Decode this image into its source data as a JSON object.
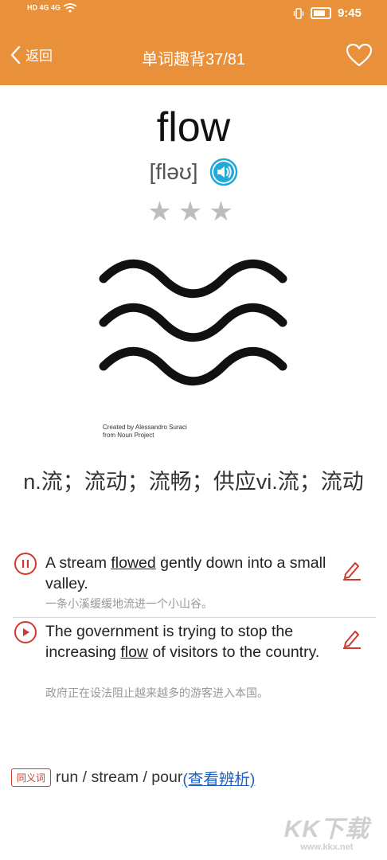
{
  "status": {
    "left": "HD 4G 4G",
    "time": "9:45"
  },
  "header": {
    "back_label": "返回",
    "title": "单词趣背37/81",
    "accent": "#e9913a"
  },
  "word": {
    "text": "flow",
    "phonetic": "[fləʊ]",
    "rating_stars": 3
  },
  "image_credit": [
    "Created by Alessandro Suraci",
    "from Noun Project"
  ],
  "meaning": "n.流；流动；流畅；供应vi.流；流动",
  "examples": [
    {
      "en_before": "A stream ",
      "keyword": "flowed",
      "en_after": " gently down into a small valley.",
      "zh": "一条小溪缓缓地流进一个小山谷。",
      "state": "pause"
    },
    {
      "en_before": "The government is trying to stop the increasing ",
      "keyword": "flow",
      "en_after": " of visitors to the country.",
      "zh": "政府正在设法阻止越来越多的游客进入本国。",
      "state": "play"
    }
  ],
  "synonyms": {
    "badge": "同义词",
    "words": "run / stream / pour",
    "link": "(查看辨析)"
  },
  "watermark": {
    "brand": "KK下载",
    "url": "www.kkx.net"
  }
}
